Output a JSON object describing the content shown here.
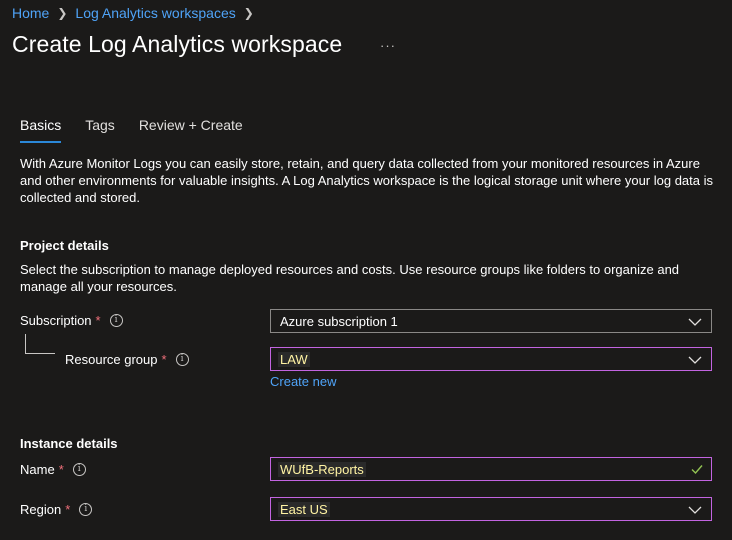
{
  "breadcrumb": {
    "items": [
      "Home",
      "Log Analytics workspaces"
    ]
  },
  "header": {
    "title": "Create Log Analytics workspace",
    "more": "···"
  },
  "tabs": [
    {
      "label": "Basics",
      "active": true
    },
    {
      "label": "Tags",
      "active": false
    },
    {
      "label": "Review + Create",
      "active": false
    }
  ],
  "intro": "With Azure Monitor Logs you can easily store, retain, and query data collected from your monitored resources in Azure and other environments for valuable insights. A Log Analytics workspace is the logical storage unit where your log data is collected and stored.",
  "project": {
    "heading": "Project details",
    "description": "Select the subscription to manage deployed resources and costs. Use resource groups like folders to organize and manage all your resources.",
    "subscription_label": "Subscription",
    "subscription_value": "Azure subscription 1",
    "resource_group_label": "Resource group",
    "resource_group_value": "LAW",
    "create_new": "Create new"
  },
  "instance": {
    "heading": "Instance details",
    "name_label": "Name",
    "name_value": "WUfB-Reports",
    "region_label": "Region",
    "region_value": "East US"
  },
  "required_marker": "*",
  "info_glyph": "i",
  "colors": {
    "background": "#1b1a19",
    "link": "#4fa3f7",
    "tab_underline": "#2b88d8",
    "required": "#f1707b",
    "highlight_border": "#c264e0",
    "valid_check": "#92c353"
  }
}
